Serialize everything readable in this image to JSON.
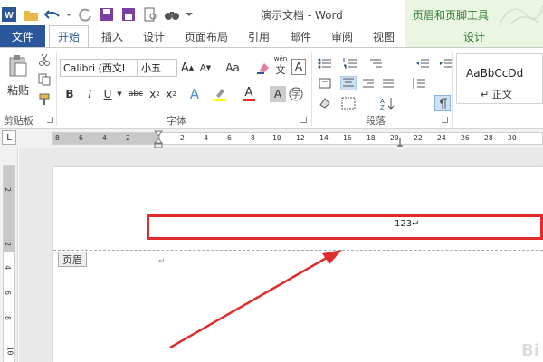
{
  "titlebar": {
    "doc_title": "演示文档 - Word",
    "context_tool_title": "页眉和页脚工具"
  },
  "tabs": {
    "file": "文件",
    "items": [
      "开始",
      "插入",
      "设计",
      "页面布局",
      "引用",
      "邮件",
      "审阅",
      "视图"
    ],
    "context_tab": "设计"
  },
  "ribbon": {
    "clipboard": {
      "paste_label": "粘贴",
      "group_label": "剪贴板"
    },
    "font": {
      "font_name": "Calibri (西文I",
      "font_size": "小五",
      "grow_label": "A",
      "shrink_label": "A",
      "case_label": "Aa",
      "bold_label": "B",
      "italic_label": "I",
      "underline_label": "U",
      "strike_label": "abc",
      "subscript_label": "x",
      "superscript_label": "x",
      "wen_label": "wén",
      "font_color_label": "A",
      "group_label": "字体"
    },
    "paragraph": {
      "group_label": "段落"
    },
    "styles": {
      "sample": "AaBbCcDd",
      "name": "↵ 正文"
    }
  },
  "ruler": {
    "corner": "L",
    "ticks": [
      "8",
      "6",
      "4",
      "2",
      "",
      "2",
      "4",
      "6",
      "8",
      "10",
      "12",
      "14",
      "16",
      "18",
      "20",
      "22",
      "24",
      "26",
      "28",
      "30"
    ],
    "vticks": [
      "2",
      "",
      "2",
      "4",
      "6",
      "8",
      "10"
    ]
  },
  "document": {
    "header_tag": "页眉",
    "header_text": "123↵",
    "para_mark": "↵",
    "watermark": "Bi"
  },
  "colors": {
    "accent": "#2b579a",
    "context": "#2e7d32",
    "highlight": "#e12c2c"
  }
}
